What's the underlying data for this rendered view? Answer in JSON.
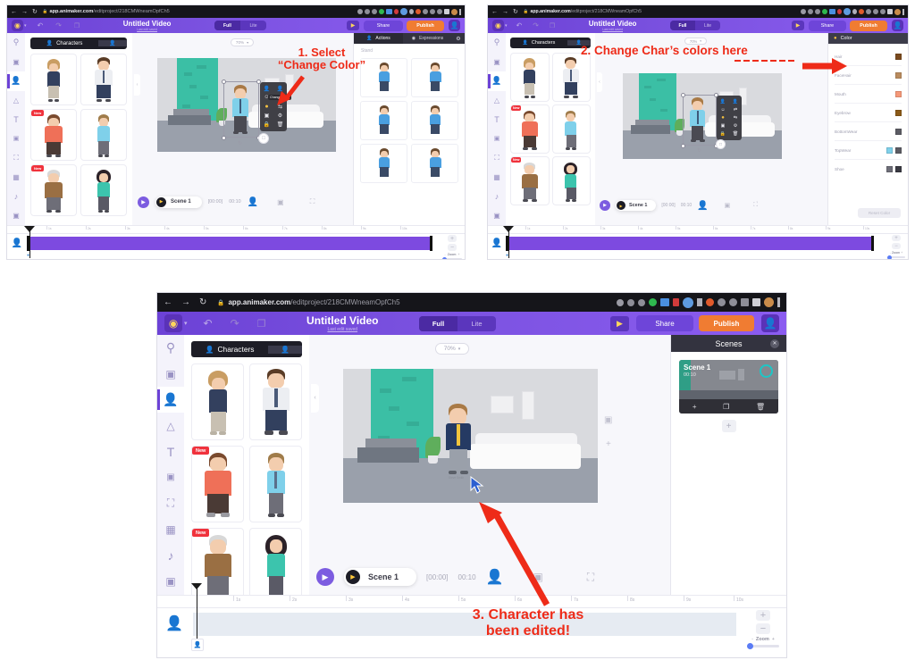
{
  "meta": {
    "app": "Animaker Video Editor",
    "panel_count": 3
  },
  "browser": {
    "url_domain": "app.animaker.com",
    "url_path": "/editproject/218CMWneamOpfCh5",
    "nav": {
      "back": "←",
      "forward": "→",
      "reload": "↻",
      "lock": "🔒"
    },
    "toolbar_icons": [
      "key-icon",
      "share-icon",
      "star-icon",
      "extension-green-icon",
      "extension-blue-icon",
      "extension-red-icon",
      "profile-globe-icon",
      "music-icon",
      "block-icon",
      "cloud-icon",
      "puzzle-icon",
      "list-icon",
      "sidepanel-icon",
      "account-avatar-icon",
      "menu-kebab-icon"
    ]
  },
  "header": {
    "logo": "animaker-logo",
    "undo": "undo-icon",
    "redo": "redo-icon",
    "copy": "copy-icon",
    "title": "Untitled Video",
    "subtitle": "Last edit saved",
    "mode_full": "Full",
    "mode_lite": "Lite",
    "play": "play-icon",
    "share": "Share",
    "publish": "Publish",
    "avatar": "user-avatar"
  },
  "rail": {
    "items": [
      {
        "name": "search",
        "icon": "search-icon",
        "active": false
      },
      {
        "name": "video",
        "icon": "video-camera-icon",
        "active": false
      },
      {
        "name": "characters",
        "icon": "character-icon",
        "active": true
      },
      {
        "name": "props",
        "icon": "props-icon",
        "active": false
      },
      {
        "name": "text",
        "icon": "text-icon",
        "active": false
      },
      {
        "name": "bg",
        "icon": "bg-icon",
        "active": false
      },
      {
        "name": "image",
        "icon": "image-icon",
        "active": false
      },
      {
        "name": "upload",
        "icon": "upload-video-icon",
        "active": false
      },
      {
        "name": "music",
        "icon": "music-note-icon",
        "active": false
      },
      {
        "name": "effects",
        "icon": "effects-icon",
        "active": false
      }
    ]
  },
  "library": {
    "tab_main": "Characters",
    "tab_secondary": "my-characters-icon",
    "badge_new": "New",
    "characters": [
      {
        "id": "c1",
        "name": "curly-hair-woman-navy-hoodie",
        "hair": "#c99d63",
        "top": "#33405e",
        "bottom": "#c8c0b2",
        "new": false
      },
      {
        "id": "c2",
        "name": "bearded-man-white-shirt-tie",
        "hair": "#6a4a2e",
        "top": "#eceef2",
        "bottom": "#32405e",
        "new": false
      },
      {
        "id": "c3",
        "name": "hipster-beard-orange-hoodie",
        "hair": "#7a4a2e",
        "top": "#ef7058",
        "bottom": "#4a3a35",
        "new": true
      },
      {
        "id": "c4",
        "name": "young-man-light-blue-shirt",
        "hair": "#a07c4a",
        "top": "#7fd0ea",
        "bottom": "#6e6e78",
        "new": false
      },
      {
        "id": "c5",
        "name": "older-man-brown-sweater",
        "hair": "#d8d8d8",
        "top": "#9a6f43",
        "bottom": "#6e6e78",
        "new": true
      },
      {
        "id": "c6",
        "name": "woman-dark-hair-teal-top",
        "hair": "#2c2228",
        "top": "#3cc4ad",
        "bottom": "#5a5a66",
        "new": false
      }
    ]
  },
  "stage": {
    "zoom_level": "70%",
    "zoom_caret": "chevron-down-icon",
    "scene_objects": [
      "green-wall",
      "sofa",
      "wall-pictures",
      "tv-stand",
      "potted-plant",
      "character"
    ]
  },
  "context_toolbar": {
    "tooltip": "Change Color",
    "items": [
      "actions-icon",
      "pose-icon",
      "expression-icon",
      "swap-icon",
      "change-color-icon",
      "flip-icon",
      "layers-icon",
      "settings-icon",
      "lock-icon",
      "delete-icon"
    ]
  },
  "right_panel_actions": {
    "tab_actions": "Actions",
    "tab_expressions": "Expressions",
    "settings": "gear-icon",
    "section_label": "Stand"
  },
  "right_panel_color": {
    "title": "Color",
    "title_icon": "palette-icon",
    "rows": [
      {
        "label": "Hair",
        "swatches": [
          "#7a4a1e"
        ]
      },
      {
        "label": "FaceHair",
        "swatches": [
          "#b98b5e"
        ]
      },
      {
        "label": "Mouth",
        "swatches": [
          "#f59878"
        ]
      },
      {
        "label": "Eyebrow",
        "swatches": [
          "#8b5a18"
        ]
      },
      {
        "label": "BottomWear",
        "swatches": [
          "#5c5c64"
        ]
      },
      {
        "label": "TopWear",
        "swatches": [
          "#7fd0ea",
          "#5c5c64"
        ]
      },
      {
        "label": "Shoe",
        "swatches": [
          "#6e6e78",
          "#3a3a42"
        ]
      }
    ],
    "reset_label": "Reset Color"
  },
  "right_panel_scenes": {
    "title": "Scenes",
    "close": "close-icon",
    "scene": {
      "label": "Scene 1",
      "duration": "00:10"
    },
    "actions": [
      "add-icon",
      "duplicate-icon",
      "delete-icon"
    ],
    "add_scene": "+"
  },
  "player": {
    "play": "play-icon",
    "scene_label": "Scene 1",
    "current_time": "[00:00]",
    "total_time": "00:10",
    "character_icon": "character-icon",
    "caption_icon": "caption-icon",
    "fullscreen_icon": "fullscreen-icon"
  },
  "timeline": {
    "ticks": [
      "1s",
      "2s",
      "3s",
      "4s",
      "5s",
      "6s",
      "7s",
      "8s",
      "9s",
      "10s"
    ],
    "track_icon": "character-track-icon",
    "zoom_in": "+",
    "zoom_out": "−",
    "zoom_label": "Zoom",
    "zoom_minus": "-",
    "zoom_plus": "+"
  },
  "annotations": {
    "step1_line1": "1. Select",
    "step1_line2": "“Change Color”",
    "step2": "2. Change Char’s colors here",
    "step3_line1": "3. Character has",
    "step3_line2": "been edited!",
    "accent": "#ee2b18"
  },
  "colors": {
    "brand_purple": "#6c42d6",
    "publish_orange": "#f07c32",
    "green_wall": "#3bbfa5",
    "timeline_purple": "#7d4ae0",
    "timeline_light": "#e6ebf2"
  }
}
